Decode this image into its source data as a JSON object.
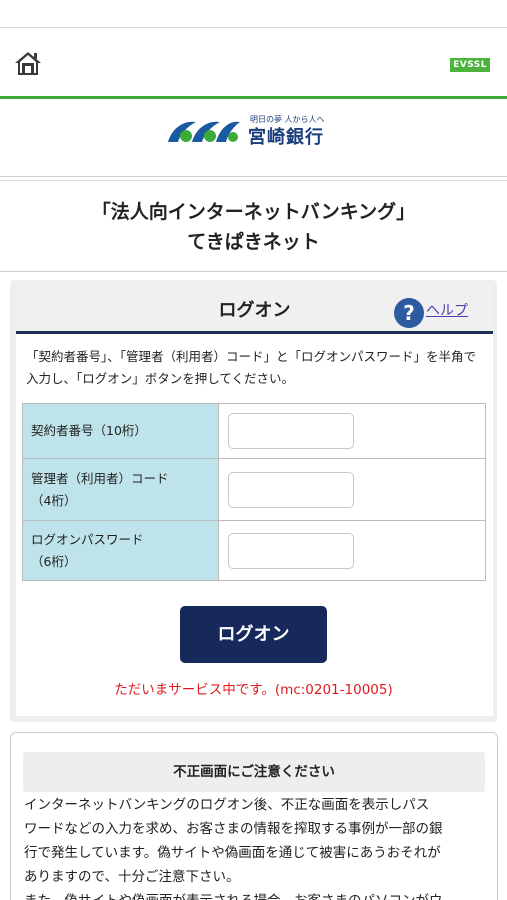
{
  "header": {
    "home_icon": "home-icon",
    "badge": "EVSSL"
  },
  "logo": {
    "tagline": "明日の夢 人から人へ",
    "name": "宮崎銀行",
    "colors": {
      "blue": "#1a5aa0",
      "green": "#3cab3b"
    }
  },
  "service_title": {
    "line1": "「法人向インターネットバンキング」",
    "line2": "てきぱきネット"
  },
  "logon": {
    "title": "ログオン",
    "help_label": "ヘルプ",
    "instructions": "「契約者番号」、「管理者（利用者）コード」と「ログオンパスワード」を半角で入力し、「ログオン」ボタンを押してください。",
    "fields": [
      {
        "label_line1": "契約者番号（10桁）",
        "label_line2": "",
        "value": ""
      },
      {
        "label_line1": "管理者（利用者）コード",
        "label_line2": "（4桁）",
        "value": ""
      },
      {
        "label_line1": "ログオンパスワード",
        "label_line2": "（6桁）",
        "value": ""
      }
    ],
    "button": "ログオン",
    "status": "ただいまサービス中です。(mc:0201-10005)"
  },
  "notice": {
    "title": "不正画面にご注意ください",
    "lines": [
      "インターネットバンキングのログオン後、不正な画面を表示しパス",
      "ワードなどの入力を求め、お客さまの情報を搾取する事例が一部の銀",
      "行で発生しています。偽サイトや偽画面を通じて被害にあうおそれが",
      "ありますので、十分ご注意下さい。",
      "また、偽サイトや偽画面が表示される場合、お客さまのパソコンがウ"
    ]
  }
}
